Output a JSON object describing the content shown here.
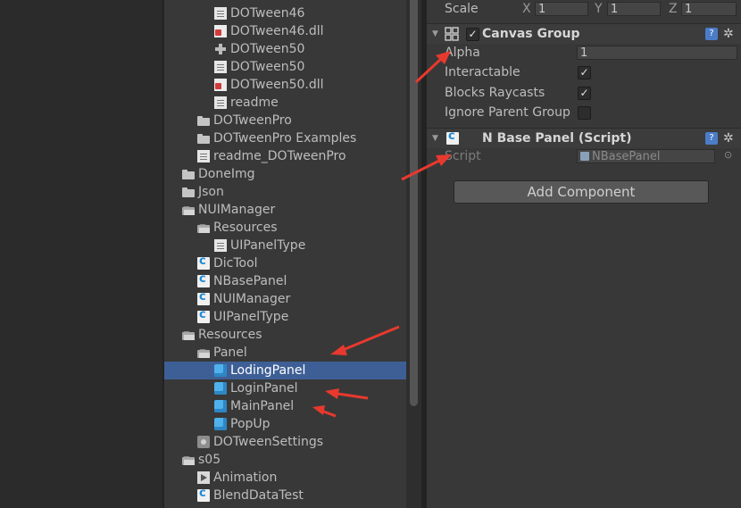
{
  "project_tree": [
    {
      "label": "DOTween46",
      "icon": "text-file-icon",
      "expanded": null,
      "selected": false
    },
    {
      "label": "DOTween46.dll",
      "icon": "dll-file-icon",
      "expanded": null,
      "selected": false
    },
    {
      "label": "DOTween50",
      "icon": "pdb-file-icon",
      "expanded": null,
      "selected": false
    },
    {
      "label": "DOTween50",
      "icon": "text-file-icon",
      "expanded": null,
      "selected": false
    },
    {
      "label": "DOTween50.dll",
      "icon": "dll-file-icon",
      "expanded": null,
      "selected": false
    },
    {
      "label": "readme",
      "icon": "text-file-icon",
      "expanded": null,
      "selected": false
    },
    {
      "label": "DOTweenPro",
      "icon": "folder-icon",
      "expanded": false,
      "selected": false
    },
    {
      "label": "DOTweenPro Examples",
      "icon": "folder-icon",
      "expanded": false,
      "selected": false
    },
    {
      "label": "readme_DOTweenPro",
      "icon": "text-file-icon",
      "expanded": null,
      "selected": false
    },
    {
      "label": "DoneImg",
      "icon": "folder-icon",
      "expanded": false,
      "selected": false
    },
    {
      "label": "Json",
      "icon": "folder-icon",
      "expanded": false,
      "selected": false
    },
    {
      "label": "NUIManager",
      "icon": "open-folder-icon",
      "expanded": true,
      "selected": false
    },
    {
      "label": "Resources",
      "icon": "open-folder-icon",
      "expanded": true,
      "selected": false
    },
    {
      "label": "UIPanelType",
      "icon": "text-file-icon",
      "expanded": null,
      "selected": false
    },
    {
      "label": "DicTool",
      "icon": "csharp-script-icon",
      "expanded": null,
      "selected": false
    },
    {
      "label": "NBasePanel",
      "icon": "csharp-script-icon",
      "expanded": null,
      "selected": false
    },
    {
      "label": "NUIManager",
      "icon": "csharp-script-icon",
      "expanded": null,
      "selected": false
    },
    {
      "label": "UIPanelType",
      "icon": "csharp-script-icon",
      "expanded": null,
      "selected": false
    },
    {
      "label": "Resources",
      "icon": "open-folder-icon",
      "expanded": true,
      "selected": false
    },
    {
      "label": "Panel",
      "icon": "open-folder-icon",
      "expanded": true,
      "selected": false
    },
    {
      "label": "LodingPanel",
      "icon": "prefab-icon",
      "expanded": false,
      "selected": true
    },
    {
      "label": "LoginPanel",
      "icon": "prefab-icon",
      "expanded": false,
      "selected": false
    },
    {
      "label": "MainPanel",
      "icon": "prefab-icon",
      "expanded": false,
      "selected": false
    },
    {
      "label": "PopUp",
      "icon": "prefab-icon",
      "expanded": false,
      "selected": false
    },
    {
      "label": "DOTweenSettings",
      "icon": "settings-asset-icon",
      "expanded": null,
      "selected": false
    },
    {
      "label": "s05",
      "icon": "open-folder-icon",
      "expanded": true,
      "selected": false
    },
    {
      "label": "Animation",
      "icon": "animation-icon",
      "expanded": null,
      "selected": false
    },
    {
      "label": "BlendDataTest",
      "icon": "csharp-script-icon",
      "expanded": null,
      "selected": false
    }
  ],
  "inspector": {
    "scale": {
      "label": "Scale",
      "x_label": "X",
      "x": "1",
      "y_label": "Y",
      "y": "1",
      "z_label": "Z",
      "z": "1"
    },
    "canvas_group": {
      "title": "Canvas Group",
      "enabled": true,
      "alpha_label": "Alpha",
      "alpha_value": "1",
      "interactable_label": "Interactable",
      "interactable": true,
      "blocks_raycasts_label": "Blocks Raycasts",
      "blocks_raycasts": true,
      "ignore_parent_groups_label": "Ignore Parent Group",
      "ignore_parent_groups": false
    },
    "script_component": {
      "title": "N Base Panel (Script)",
      "script_label": "Script",
      "script_value": "NBasePanel"
    },
    "add_component_label": "Add Component"
  },
  "colors": {
    "selection": "#3e5f96",
    "annotation_arrow": "#e8392e"
  }
}
